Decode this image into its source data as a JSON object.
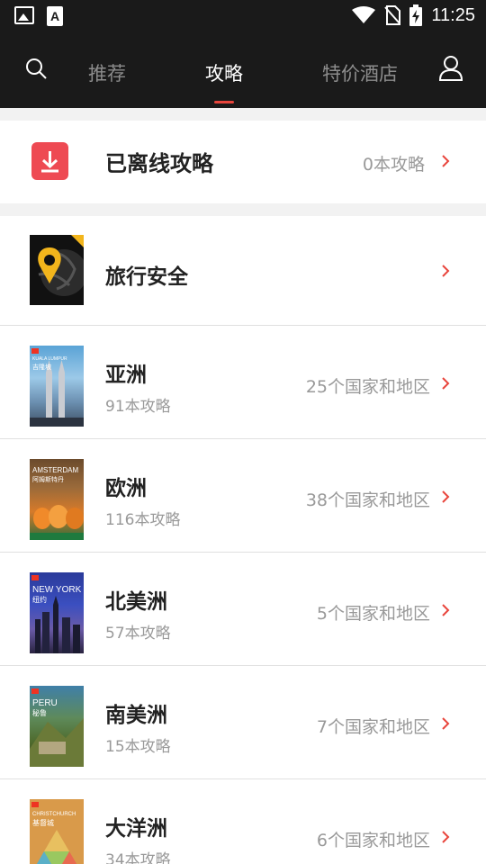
{
  "status_bar": {
    "time": "11:25"
  },
  "top_nav": {
    "tabs": [
      {
        "label": "推荐"
      },
      {
        "label": "攻略"
      },
      {
        "label": "特价酒店"
      }
    ]
  },
  "offline": {
    "title": "已离线攻略",
    "count": "0本攻略"
  },
  "safety": {
    "title": "旅行安全"
  },
  "regions": [
    {
      "title": "亚洲",
      "sub": "91本攻略",
      "count": "25个国家和地区"
    },
    {
      "title": "欧洲",
      "sub": "116本攻略",
      "count": "38个国家和地区"
    },
    {
      "title": "北美洲",
      "sub": "57本攻略",
      "count": "5个国家和地区"
    },
    {
      "title": "南美洲",
      "sub": "15本攻略",
      "count": "7个国家和地区"
    },
    {
      "title": "大洋洲",
      "sub": "34本攻略",
      "count": "6个国家和地区"
    }
  ],
  "covers": [
    {
      "caption": "KUALA LUMPUR",
      "sub": "吉隆坡"
    },
    {
      "caption": "AMSTERDAM",
      "sub": "阿姆斯特丹"
    },
    {
      "caption": "NEW YORK",
      "sub": "纽约"
    },
    {
      "caption": "PERU",
      "sub": "秘鲁"
    },
    {
      "caption": "CHRISTCHURCH",
      "sub": "基督城"
    }
  ],
  "colors": {
    "accent": "#e8453c",
    "download": "#ee4a53",
    "nav_bg": "#1a1a1a"
  }
}
